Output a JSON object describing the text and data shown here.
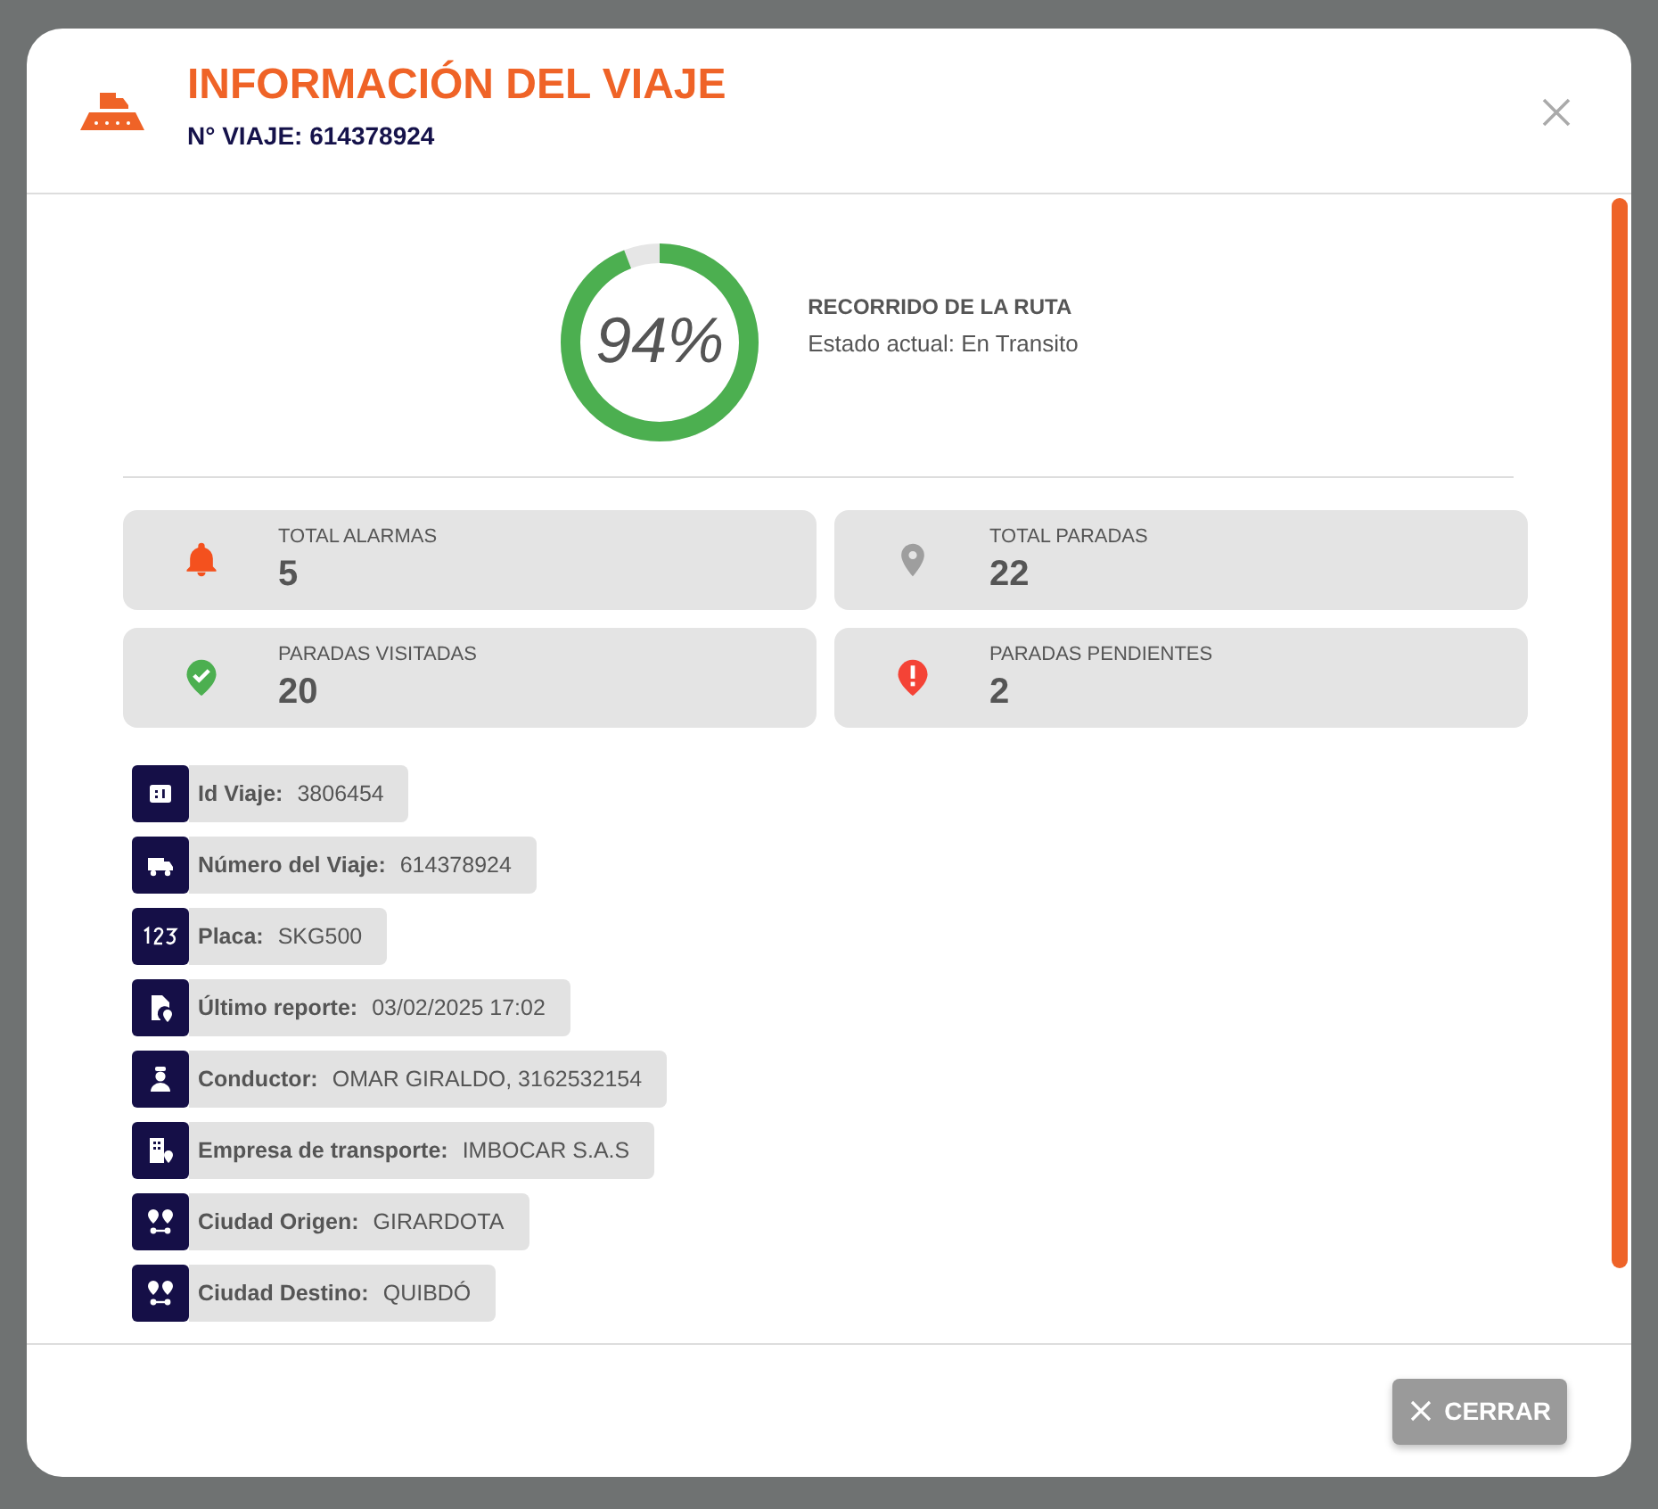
{
  "modal": {
    "title": "INFORMACIÓN DEL VIAJE",
    "subtitle": "N° VIAJE: 614378924"
  },
  "progress": {
    "level": 0.94,
    "reading": "94%",
    "title": "RECORRIDO DE LA RUTA",
    "status": "Estado actual: En Transito"
  },
  "stats": [
    {
      "kind": "bell",
      "color": "#f4511e",
      "label": "TOTAL ALARMAS",
      "value": "5"
    },
    {
      "kind": "pin",
      "color": "#9e9e9e",
      "label": "TOTAL PARADAS",
      "value": "22"
    },
    {
      "kind": "check",
      "color": "#4caf50",
      "label": "PARADAS VISITADAS",
      "value": "20"
    },
    {
      "kind": "alert",
      "color": "#f44336",
      "label": "PARADAS PENDIENTES",
      "value": "2"
    }
  ],
  "details": [
    {
      "kind": "id",
      "label": "Id Viaje:",
      "value": "3806454"
    },
    {
      "kind": "truck",
      "label": "Número del Viaje:",
      "value": "614378924"
    },
    {
      "kind": "numbers",
      "label": "Placa:",
      "value": "SKG500"
    },
    {
      "kind": "report",
      "label": "Último reporte:",
      "value": "03/02/2025 17:02"
    },
    {
      "kind": "driver",
      "label": "Conductor:",
      "value": "OMAR GIRALDO, 3162532154"
    },
    {
      "kind": "company",
      "label": "Empresa de transporte:",
      "value": "IMBOCAR S.A.S"
    },
    {
      "kind": "route",
      "label": "Ciudad Origen:",
      "value": "GIRARDOTA"
    },
    {
      "kind": "route",
      "label": "Ciudad Destino:",
      "value": "QUIBDÓ"
    }
  ],
  "close_button": "CERRAR"
}
